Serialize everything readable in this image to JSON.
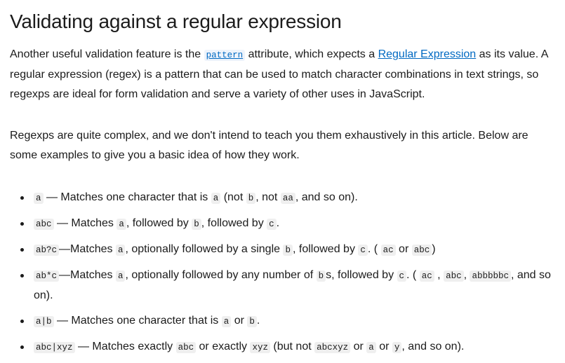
{
  "heading": "Validating against a regular expression",
  "para1": {
    "t1": "Another useful validation feature is the ",
    "code_pattern": "pattern",
    "t2": " attribute, which expects a ",
    "link_regex": "Regular Expression",
    "t3": " as its value. A regular expression (regex) is a pattern that can be used to match character combinations in text strings, so regexps are ideal for form validation and serve a variety of other uses in JavaScript."
  },
  "para2": "Regexps are quite complex, and we don't intend to teach you them exhaustively in this article. Below are some examples to give you a basic idea of how they work.",
  "list": {
    "i1": {
      "c1": "a",
      "t1": " — Matches one character that is ",
      "c2": "a",
      "t2": " (not ",
      "c3": "b",
      "t3": ", not ",
      "c4": "aa",
      "t4": ", and so on)."
    },
    "i2": {
      "c1": "abc",
      "t1": " — Matches ",
      "c2": "a",
      "t2": ", followed by ",
      "c3": "b",
      "t3": ", followed by ",
      "c4": "c",
      "t4": "."
    },
    "i3": {
      "c1": "ab?c",
      "t1": "—Matches ",
      "c2": "a",
      "t2": ", optionally followed by a single ",
      "c3": "b",
      "t3": ", followed by ",
      "c4": "c",
      "t4": ". ( ",
      "c5": "ac",
      "t5": " or ",
      "c6": "abc",
      "t6": ")"
    },
    "i4": {
      "c1": "ab*c",
      "t1": "—Matches ",
      "c2": "a",
      "t2": ", optionally followed by any number of ",
      "c3": "b",
      "t3": "s, followed by ",
      "c4": "c",
      "t4": ". ( ",
      "c5": "ac",
      "t5": " , ",
      "c6": "abc",
      "t6": ", ",
      "c7": "abbbbbc",
      "t7": ", and so on)."
    },
    "i5": {
      "c1": "a|b",
      "t1": " — Matches one character that is ",
      "c2": "a",
      "t2": " or ",
      "c3": "b",
      "t3": "."
    },
    "i6": {
      "c1": "abc|xyz",
      "t1": " — Matches exactly ",
      "c2": "abc",
      "t2": " or exactly ",
      "c3": "xyz",
      "t3": " (but not ",
      "c4": "abcxyz",
      "t4": " or ",
      "c5": "a",
      "t5": " or ",
      "c6": "y",
      "t6": ", and so on)."
    }
  }
}
